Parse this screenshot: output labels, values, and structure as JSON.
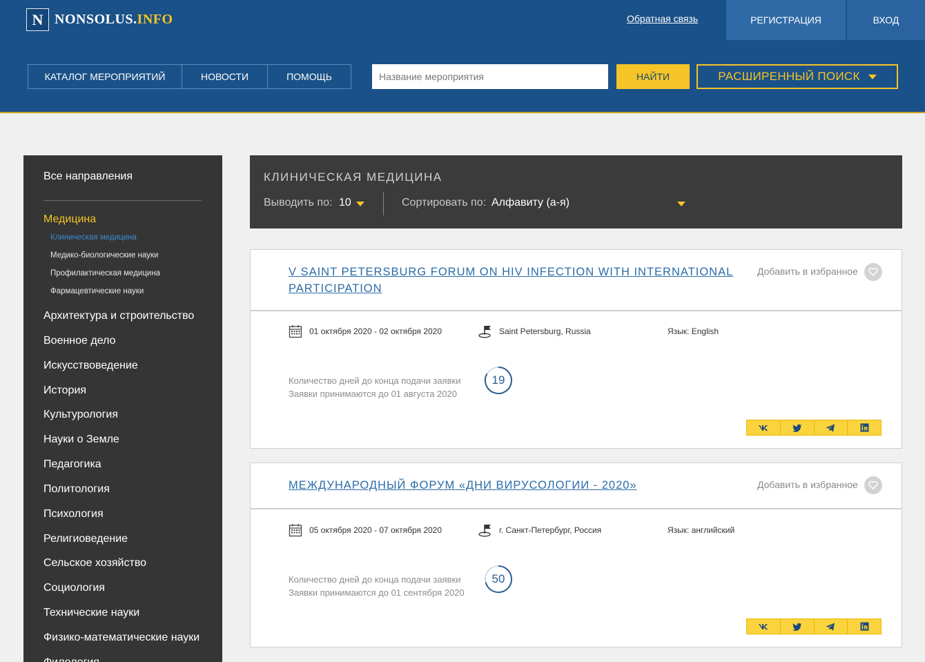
{
  "header": {
    "logo_letter": "N",
    "logo_name": "NONSOLUS.",
    "logo_domain": "INFO",
    "feedback": "Обратная связь",
    "register": "РЕГИСТРАЦИЯ",
    "login": "ВХОД"
  },
  "nav": {
    "items": [
      {
        "label": "КАТАЛОГ МЕРОПРИЯТИЙ"
      },
      {
        "label": "НОВОСТИ"
      },
      {
        "label": "ПОМОЩЬ"
      }
    ],
    "search_placeholder": "Название мероприятия",
    "find": "НАЙТИ",
    "advanced": "РАСШИРЕННЫЙ ПОИСК"
  },
  "sidebar": {
    "all": "Все направления",
    "active": "Медицина",
    "subitems": [
      {
        "label": "Клиническая медицина",
        "current": true
      },
      {
        "label": "Медико-биологические науки"
      },
      {
        "label": "Профилактическая медицина"
      },
      {
        "label": "Фармацевтические науки"
      }
    ],
    "categories": [
      "Архитектура и строительство",
      "Военное дело",
      "Искусствоведение",
      "История",
      "Культурология",
      "Науки о Земле",
      "Педагогика",
      "Политология",
      "Психология",
      "Религиоведение",
      "Сельское хозяйство",
      "Социология",
      "Технические науки",
      "Физико-математические науки",
      "Филология"
    ]
  },
  "listing": {
    "title": "КЛИНИЧЕСКАЯ МЕДИЦИНА",
    "per_page_label": "Выводить по:",
    "per_page_value": "10",
    "sort_label": "Сортировать по:",
    "sort_value": "Алфавиту (а-я)"
  },
  "events": [
    {
      "title": "V SAINT PETERSBURG FORUM ON HIV INFECTION WITH INTERNATIONAL PARTICIPATION",
      "favorite": "Добавить в избранное",
      "dates": "01 октября 2020 - 02 октября 2020",
      "location": "Saint Petersburg, Russia",
      "language": "Язык: English",
      "days_label": "Количество дней до конца подачи заявки",
      "deadline": "Заявки принимаются до 01 августа 2020",
      "days_left": "19"
    },
    {
      "title": "МЕЖДУНАРОДНЫЙ ФОРУМ «ДНИ ВИРУСОЛОГИИ - 2020»",
      "favorite": "Добавить в избранное",
      "dates": "05 октября 2020 - 07 октября 2020",
      "location": "г. Санкт-Петербург, Россия",
      "language": "Язык: английский",
      "days_label": "Количество дней до конца подачи заявки",
      "deadline": "Заявки принимаются до 01 сентября 2020",
      "days_left": "50"
    }
  ],
  "social": [
    "vk-icon",
    "twitter-icon",
    "telegram-icon",
    "linkedin-icon"
  ],
  "colors": {
    "brand_blue": "#1a5188",
    "accent_yellow": "#f6c426",
    "sidebar_dark": "#353535",
    "link_blue": "#2a6ba8"
  }
}
